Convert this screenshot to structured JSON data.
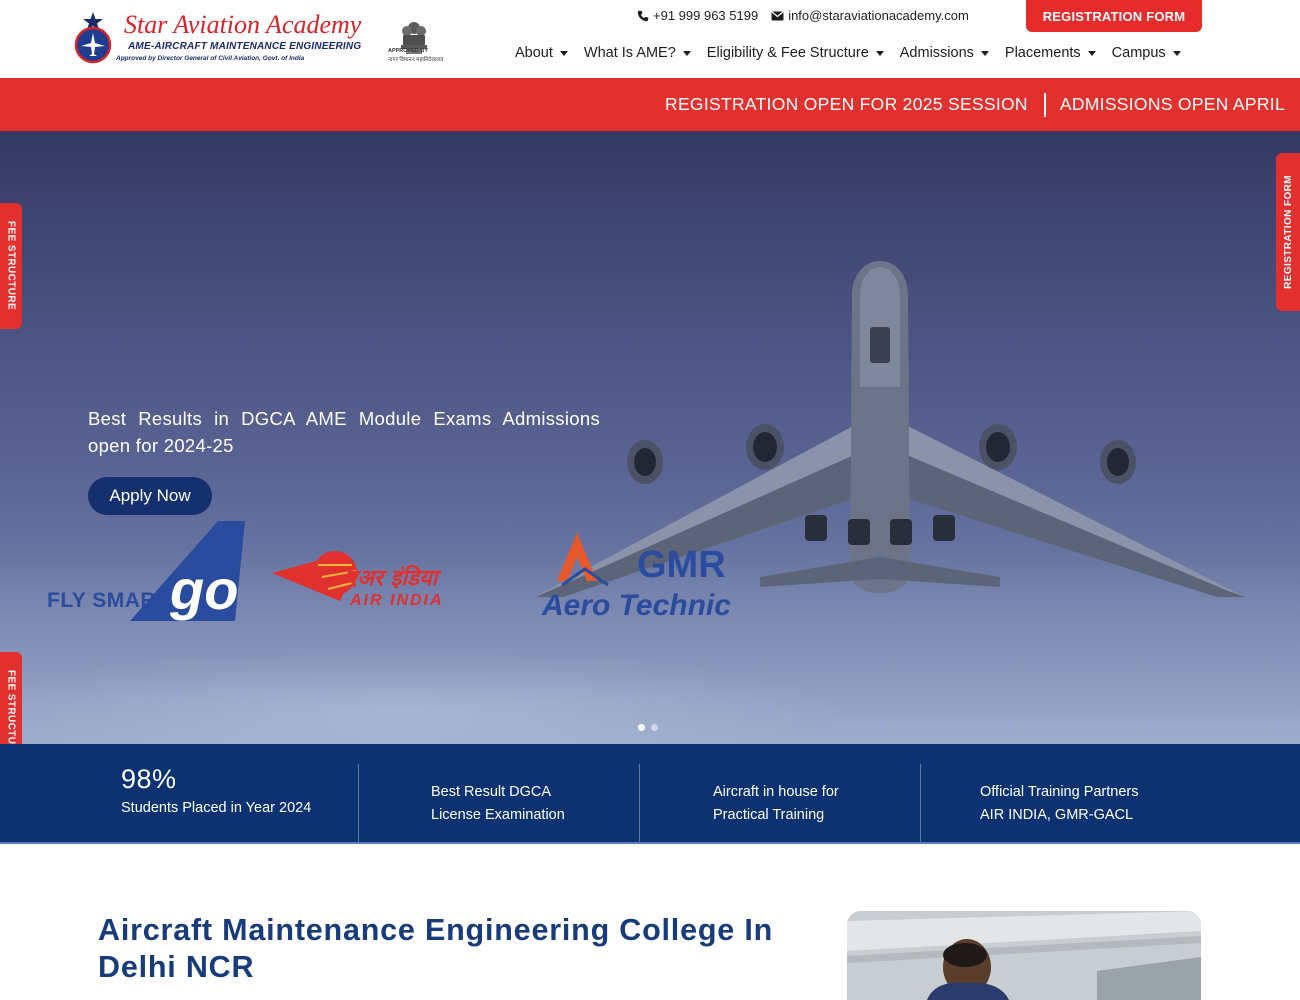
{
  "header": {
    "brand_title": "Star Aviation Academy",
    "brand_subtitle": "AME-AIRCRAFT MAINTENANCE ENGINEERING",
    "brand_approval": "Approved by Director General of Civil Aviation, Govt. of India",
    "govt_badge_line1": "APPROVED BY",
    "govt_badge_line2": "नागर विमानन महानिदेशालय",
    "phone": "+91 999 963 5199",
    "email": "info@staraviationacademy.com",
    "registration_button": "REGISTRATION FORM"
  },
  "nav": {
    "items": [
      {
        "label": "About"
      },
      {
        "label": "What Is AME?"
      },
      {
        "label": "Eligibility & Fee Structure"
      },
      {
        "label": "Admissions"
      },
      {
        "label": "Placements"
      },
      {
        "label": "Campus"
      }
    ]
  },
  "ticker": {
    "item1": "REGISTRATION OPEN FOR 2025 SESSION",
    "item2": "ADMISSIONS OPEN APRIL"
  },
  "hero": {
    "headline": "Best Results in DGCA AME Module Exams Admissions open for 2024-25",
    "cta": "Apply Now",
    "partner_go_tagline": "FLY SMART",
    "partner_go_mark": "go",
    "partner_airindia_hindi": "एअर इंडिया",
    "partner_airindia": "AIR INDIA",
    "partner_gmr": "GMR",
    "partner_gmr_sub": "Aero Technic",
    "slides_total": 2,
    "slide_active": 1
  },
  "side_tabs": {
    "left_top": "FEE STRUCTURE",
    "left_bottom": "FEE STRUCTURE",
    "right": "REGISTRATION FORM"
  },
  "stats": [
    {
      "big": "98%",
      "line1": "Students Placed in Year 2024",
      "line2": ""
    },
    {
      "big": "",
      "line1": "Best Result DGCA",
      "line2": "License Examination"
    },
    {
      "big": "",
      "line1": "Aircraft in house for",
      "line2": "Practical Training"
    },
    {
      "big": "",
      "line1": "Official Training Partners",
      "line2": "AIR INDIA, GMR-GACL"
    }
  ],
  "content": {
    "heading_line1": "Aircraft Maintenance Engineering College In",
    "heading_line2": "Delhi NCR"
  },
  "colors": {
    "accent_red": "#e2302e",
    "navy": "#0c3272",
    "heading_blue": "#173b7d"
  }
}
